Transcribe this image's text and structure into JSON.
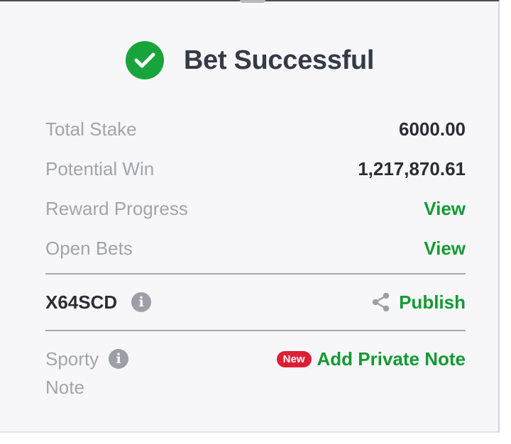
{
  "header": {
    "title": "Bet Successful",
    "icon": "check-circle-icon",
    "icon_color": "#17a53b"
  },
  "summary": {
    "total_stake_label": "Total Stake",
    "total_stake_value": "6000.00",
    "potential_win_label": "Potential Win",
    "potential_win_value": "1,217,870.61",
    "reward_progress_label": "Reward Progress",
    "reward_progress_link": "View",
    "open_bets_label": "Open Bets",
    "open_bets_link": "View"
  },
  "booking": {
    "code": "X64SCD",
    "info_icon": "info-icon",
    "share_icon": "share-icon",
    "publish_label": "Publish"
  },
  "note": {
    "label_line1": "Sporty",
    "label_line2": "Note",
    "badge": "New",
    "add_label": "Add Private Note"
  },
  "colors": {
    "accent_green": "#139a34",
    "badge_red": "#dd1f35",
    "muted_text": "#a1a4ad",
    "dark_text": "#2a2d35"
  }
}
